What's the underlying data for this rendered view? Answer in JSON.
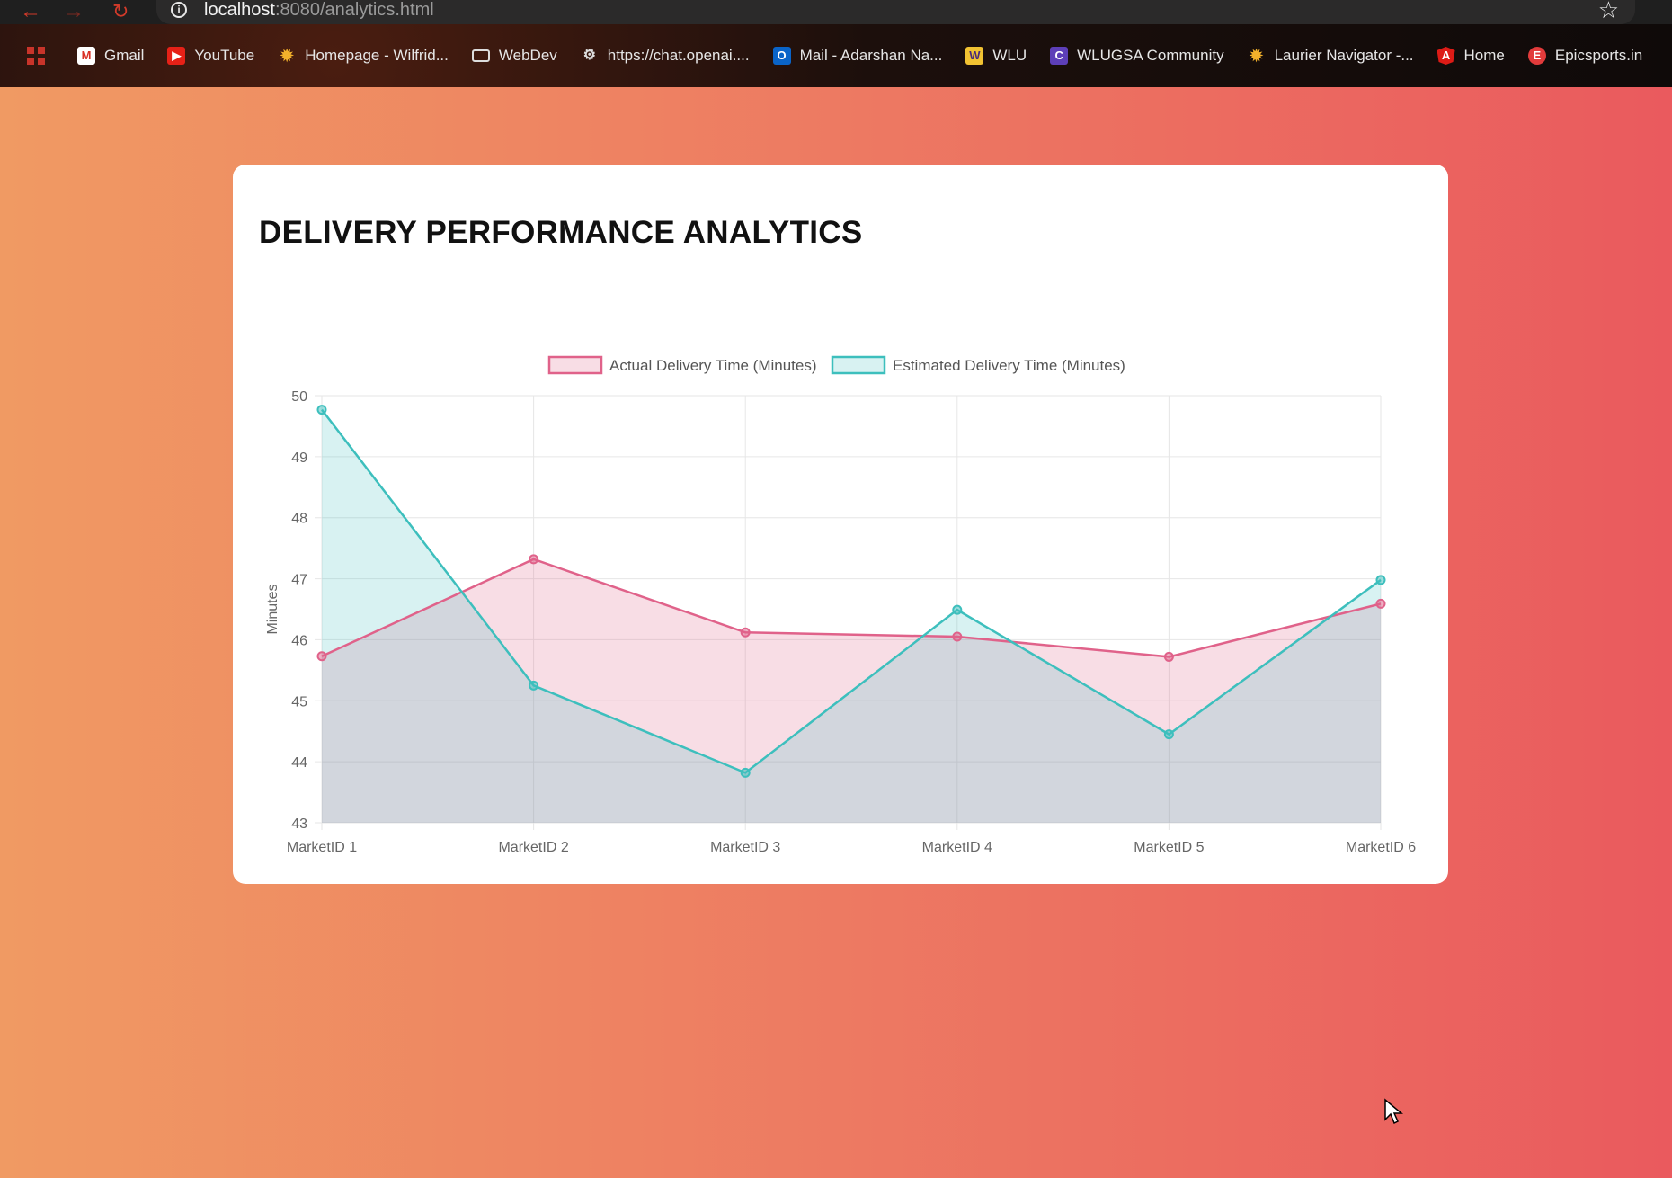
{
  "browser": {
    "url_host": "localhost",
    "url_path": ":8080/analytics.html",
    "bookmarks": [
      {
        "label": "Gmail",
        "icon": "gmail-icon"
      },
      {
        "label": "YouTube",
        "icon": "youtube-icon"
      },
      {
        "label": "Homepage - Wilfrid...",
        "icon": "maple-leaf-icon"
      },
      {
        "label": "WebDev",
        "icon": "folder-icon"
      },
      {
        "label": "https://chat.openai....",
        "icon": "openai-icon"
      },
      {
        "label": "Mail - Adarshan Na...",
        "icon": "outlook-icon"
      },
      {
        "label": "WLU",
        "icon": "wlu-icon"
      },
      {
        "label": "WLUGSA Community",
        "icon": "community-icon"
      },
      {
        "label": "Laurier Navigator -...",
        "icon": "maple-leaf-icon"
      },
      {
        "label": "Home",
        "icon": "angular-icon"
      },
      {
        "label": "Epicsports.in",
        "icon": "epicsports-icon"
      }
    ]
  },
  "page": {
    "title": "DELIVERY PERFORMANCE ANALYTICS"
  },
  "colors": {
    "actual": "#e0628a",
    "estimated": "#3dbfbd"
  },
  "chart_data": {
    "type": "line",
    "title": "",
    "xlabel": "",
    "ylabel": "Minutes",
    "categories": [
      "MarketID 1",
      "MarketID 2",
      "MarketID 3",
      "MarketID 4",
      "MarketID 5",
      "MarketID 6"
    ],
    "ylim": [
      43,
      50
    ],
    "yticks": [
      "43",
      "44",
      "45",
      "46",
      "47",
      "48",
      "49",
      "50"
    ],
    "legend_position": "top",
    "grid": true,
    "filled": true,
    "series": [
      {
        "name": "Actual Delivery Time (Minutes)",
        "values": [
          45.73,
          47.32,
          46.12,
          46.05,
          45.72,
          46.59
        ]
      },
      {
        "name": "Estimated Delivery Time (Minutes)",
        "values": [
          49.77,
          45.25,
          43.82,
          46.49,
          44.45,
          46.98
        ]
      }
    ]
  }
}
